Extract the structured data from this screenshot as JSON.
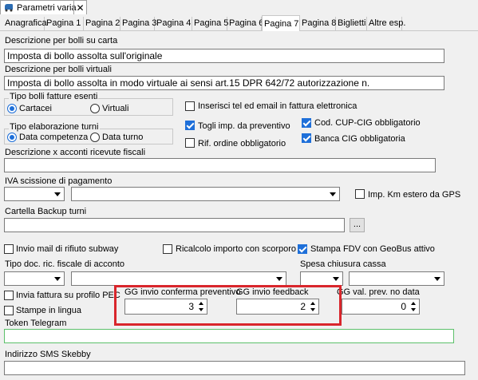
{
  "window": {
    "title": "Parametri varia",
    "close_glyph": "✕"
  },
  "tabs": [
    "Anagrafica",
    "Pagina 1",
    "Pagina 2",
    "Pagina 3",
    "Pagina 4",
    "Pagina 5",
    "Pagina 6",
    "Pagina 7",
    "Pagina 8",
    "Biglietti",
    "Altre esp."
  ],
  "active_tab": "Pagina 7",
  "descr_bolli_carta": {
    "label": "Descrizione per bolli su carta",
    "value": "Imposta di bollo assolta sull'originale"
  },
  "descr_bolli_virtuali": {
    "label": "Descrizione per bolli virtuali",
    "value": "Imposta di bollo assolta in modo virtuale ai sensi art.15 DPR 642/72 autorizzazione n."
  },
  "tipo_bolli": {
    "title": "Tipo bolli fatture esenti",
    "opt1": "Cartacei",
    "opt2": "Virtuali",
    "selected": "Cartacei"
  },
  "tipo_elab": {
    "title": "Tipo elaborazione turni",
    "opt1": "Data competenza",
    "opt2": "Data turno",
    "selected": "Data competenza"
  },
  "checks": {
    "inserisci_tel": {
      "label": "Inserisci tel ed email in fattura elettronica",
      "checked": false
    },
    "togli_imp": {
      "label": "Togli imp. da preventivo",
      "checked": true
    },
    "cod_cup": {
      "label": "Cod. CUP-CIG obbligatorio",
      "checked": true
    },
    "rif_ordine": {
      "label": "Rif. ordine obbligatorio",
      "checked": false
    },
    "banca_cig": {
      "label": "Banca CIG obbligatoria",
      "checked": true
    },
    "imp_km": {
      "label": "Imp. Km estero da GPS",
      "checked": false
    },
    "invio_mail": {
      "label": "Invio mail di rifiuto subway",
      "checked": false
    },
    "ricalcolo": {
      "label": "Ricalcolo importo con scorporo",
      "checked": false
    },
    "stampa_fdv": {
      "label": "Stampa FDV con GeoBus attivo",
      "checked": true
    },
    "invia_fattura": {
      "label": "Invia fattura su profilo PEC",
      "checked": false
    },
    "stampe_lingua": {
      "label": "Stampe in lingua",
      "checked": false
    }
  },
  "descr_acconti": {
    "label": "Descrizione x acconti ricevute fiscali",
    "value": ""
  },
  "iva_scissione": {
    "label": "IVA scissione di pagamento"
  },
  "cartella_backup": {
    "label": "Cartella Backup turni",
    "value": "",
    "browse": "..."
  },
  "tipo_doc": {
    "label": "Tipo doc. ric. fiscale di acconto"
  },
  "spesa_chiusura": {
    "label": "Spesa chiusura cassa"
  },
  "gg_conferma": {
    "label": "GG invio conferma preventivo",
    "value": "3"
  },
  "gg_feedback": {
    "label": "GG invio feedback",
    "value": "2"
  },
  "gg_val_prev": {
    "label": "GG val. prev. no data",
    "value": "0"
  },
  "token_telegram": {
    "label": "Token Telegram",
    "value": ""
  },
  "sms_skebby": {
    "label": "Indirizzo SMS Skebby",
    "value": ""
  },
  "colors": {
    "accent": "#1e6fd9",
    "highlight": "#d9262c",
    "focus_green": "#5cc06a"
  }
}
